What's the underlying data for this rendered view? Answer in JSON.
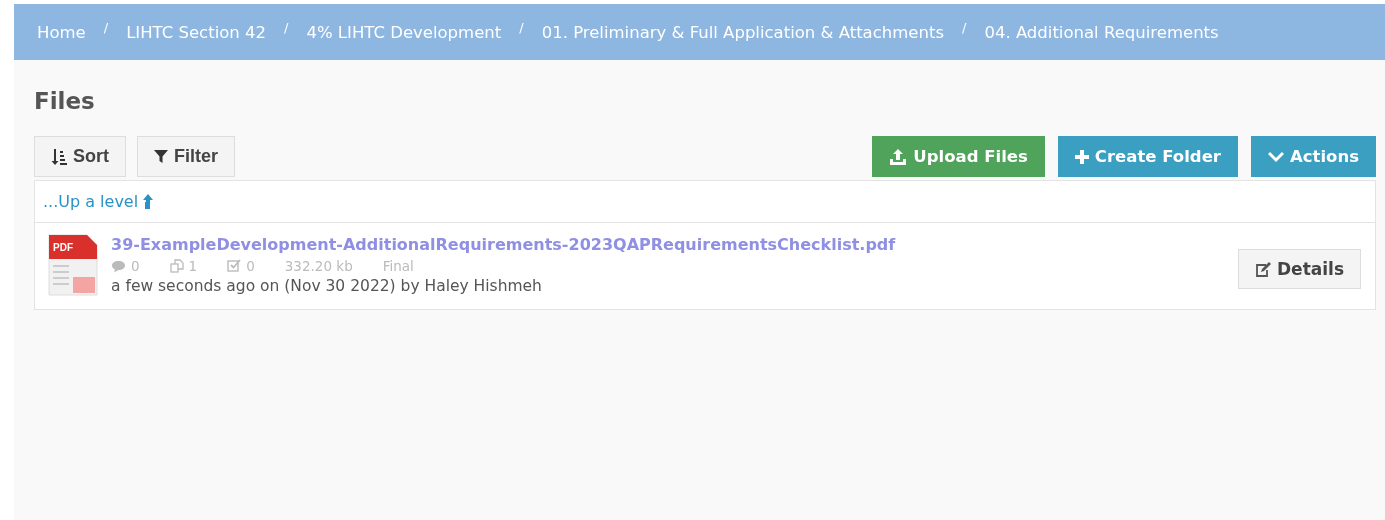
{
  "breadcrumbs": [
    "Home",
    "LIHTC Section 42",
    "4% LIHTC Development",
    "01. Preliminary & Full Application & Attachments",
    "04. Additional Requirements"
  ],
  "separator": "/",
  "title": "Files",
  "left_buttons": [
    {
      "kind": "sort",
      "label": "Sort"
    },
    {
      "kind": "filter",
      "label": "Filter"
    }
  ],
  "right_buttons": [
    {
      "kind": "upload",
      "label": "Upload Files"
    },
    {
      "kind": "create",
      "label": "Create Folder"
    },
    {
      "kind": "actions",
      "label": "Actions"
    }
  ],
  "up_level": "...Up a level",
  "files": [
    {
      "icon_label": "PDF",
      "name": "39-ExampleDevelopment-AdditionalRequirements-2023QAPRequirementsChecklist.pdf",
      "comments": "0",
      "versions": "1",
      "tasks": "0",
      "size": "332.20 kb",
      "status": "Final",
      "info": "a few seconds ago on (Nov 30 2022) by Haley Hishmeh",
      "button": "Details"
    }
  ]
}
